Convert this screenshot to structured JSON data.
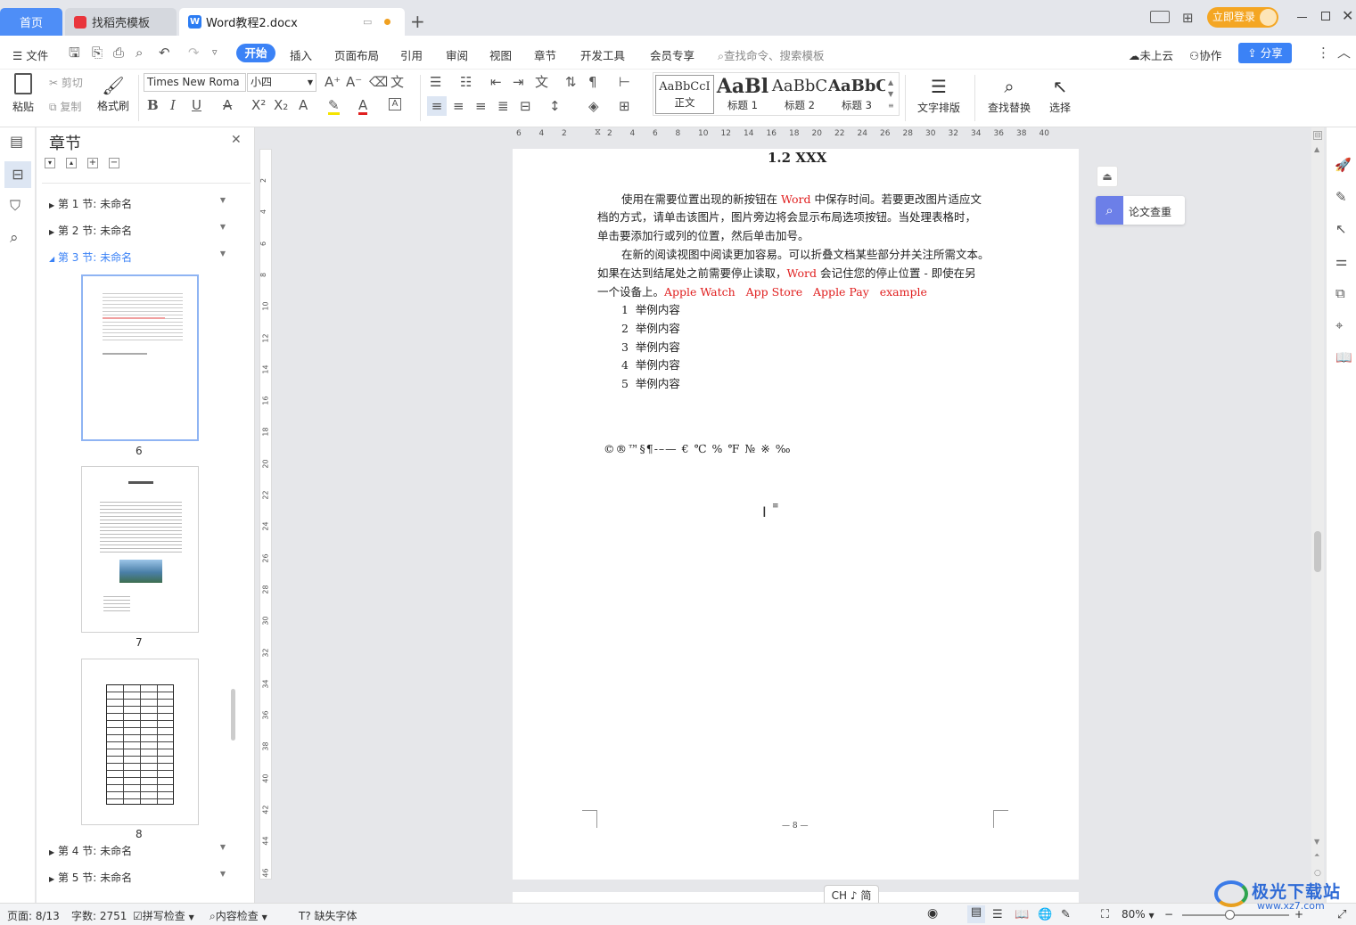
{
  "tabs": {
    "home": "首页",
    "template": "找稻壳模板",
    "doc": "Word教程2.docx",
    "add": "+"
  },
  "window": {
    "login": "立即登录"
  },
  "menu": {
    "file": "文件",
    "start": "开始",
    "insert": "插入",
    "layout": "页面布局",
    "ref": "引用",
    "review": "审阅",
    "view": "视图",
    "chapter": "章节",
    "dev": "开发工具",
    "vip": "会员专享",
    "search": "查找命令、搜索模板",
    "cloud": "未上云",
    "collab": "协作",
    "share": "分享"
  },
  "ribbon": {
    "paste": "粘贴",
    "cut": "剪切",
    "copy": "复制",
    "format_painter": "格式刷",
    "font": "Times New Roma",
    "size": "小四",
    "text_layout": "文字排版",
    "find_replace": "查找替换",
    "select": "选择"
  },
  "styles": [
    {
      "sample": "AaBbCcI",
      "name": "正文"
    },
    {
      "sample": "AaBl",
      "name": "标题 1"
    },
    {
      "sample": "AaBbC",
      "name": "标题 2"
    },
    {
      "sample": "AaBbC",
      "name": "标题 3"
    }
  ],
  "nav": {
    "title": "章节",
    "s1": "第 1 节: 未命名",
    "s2": "第 2 节: 未命名",
    "s3": "第 3 节: 未命名",
    "s4": "第 4 节: 未命名",
    "s5": "第 5 节: 未命名",
    "p6": "6",
    "p7": "7",
    "p8": "8"
  },
  "doc": {
    "heading": "1.2 XXX",
    "l1a": "使用在需要位置出现的新按钮在 ",
    "l1w": "Word",
    "l1b": " 中保存时间。若要更改图片适应文",
    "l2": "档的方式，请单击该图片，图片旁边将会显示布局选项按钮。当处理表格时，",
    "l3": "单击要添加行或列的位置，然后单击加号。",
    "l4": "在新的阅读视图中阅读更加容易。可以折叠文档某些部分并关注所需文本。",
    "l5a": "如果在达到结尾处之前需要停止读取，",
    "l5w": "Word",
    "l5b": " 会记住您的停止位置 - 即使在另",
    "l6a": "一个设备上。",
    "l6r": "Apple Watch   App Store   Apple Pay   example",
    "list": [
      "1  举例内容",
      "2  举例内容",
      "3  举例内容",
      "4  举例内容",
      "5  举例内容"
    ],
    "symbols": "©®™§¶-–— € ℃ % ℉ № ※ ‰",
    "footer": "— 8 —"
  },
  "side": {
    "paper_check": "论文查重"
  },
  "ime": "CH ♪ 简",
  "status": {
    "page": "页面: 8/13",
    "words": "字数: 2751",
    "spell": "拼写检查",
    "content": "内容检查",
    "missing_font": "缺失字体",
    "zoom": "80%"
  },
  "ruler_h": [
    "6",
    "4",
    "2",
    "",
    "2",
    "4",
    "6",
    "8",
    "10",
    "12",
    "14",
    "16",
    "18",
    "20",
    "22",
    "24",
    "26",
    "28",
    "30",
    "32",
    "34",
    "36",
    "38",
    "40"
  ],
  "ruler_v": [
    "2",
    "4",
    "6",
    "8",
    "10",
    "12",
    "14",
    "16",
    "18",
    "20",
    "22",
    "24",
    "26",
    "28",
    "30",
    "32",
    "34",
    "36",
    "38",
    "40",
    "42",
    "44",
    "46"
  ],
  "watermark": "极光下载站 www.xz7.com"
}
